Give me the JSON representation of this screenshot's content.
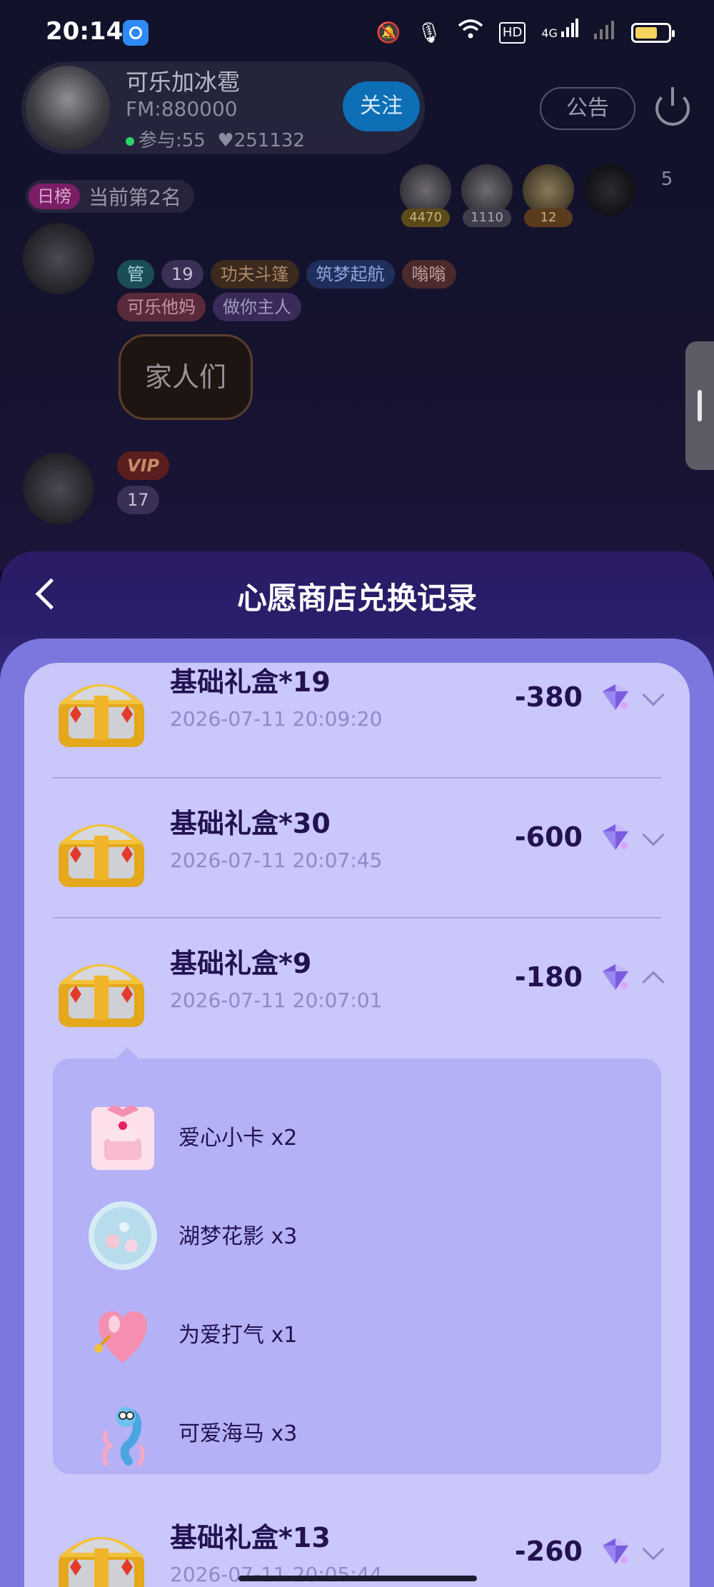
{
  "status_bar": {
    "time": "20:14",
    "network": "4G"
  },
  "room": {
    "host_name": "可乐加冰雹",
    "host_fm": "FM:880000",
    "participants": "参与:55",
    "likes": "251132",
    "follow_label": "关注",
    "notice_label": "公告",
    "rank_tag": "日榜",
    "rank_text": "当前第2名",
    "top_fans": [
      {
        "score": "4470"
      },
      {
        "score": "1110"
      },
      {
        "score": "12"
      },
      {
        "score": ""
      }
    ],
    "fan_count": "5",
    "chat": {
      "row1_badges": [
        "管",
        "19",
        "功夫斗篷",
        "筑梦起航",
        "嗡嗡"
      ],
      "row1_tags": [
        "可乐他妈",
        "做你主人"
      ],
      "message": "家人们",
      "row2_vip": "VIP",
      "row2_level": "17"
    }
  },
  "sheet": {
    "title": "心愿商店兑换记录",
    "records": [
      {
        "name": "基础礼盒*19",
        "time": "2026-07-11 20:09:20",
        "amount": "-380",
        "expanded": false
      },
      {
        "name": "基础礼盒*30",
        "time": "2026-07-11 20:07:45",
        "amount": "-600",
        "expanded": false
      },
      {
        "name": "基础礼盒*9",
        "time": "2026-07-11 20:07:01",
        "amount": "-180",
        "expanded": true
      },
      {
        "name": "基础礼盒*13",
        "time": "2026-07-11 20:05:44",
        "amount": "-260",
        "expanded": false
      }
    ],
    "detail_items": [
      {
        "label": "爱心小卡 x2",
        "icon": "cake-card-icon"
      },
      {
        "label": "湖梦花影 x3",
        "icon": "flower-bubble-icon"
      },
      {
        "label": "为爱打气 x1",
        "icon": "heart-balloon-icon"
      },
      {
        "label": "可爱海马 x3",
        "icon": "seahorse-icon"
      }
    ]
  },
  "colors": {
    "sheet_bg": "#2c1a66",
    "panel_bg": "#7b77de",
    "card_bg": "#cac7fb",
    "detail_bg": "#b4b1f6",
    "text_dark": "#22124f",
    "text_time": "#8e8ac8"
  }
}
